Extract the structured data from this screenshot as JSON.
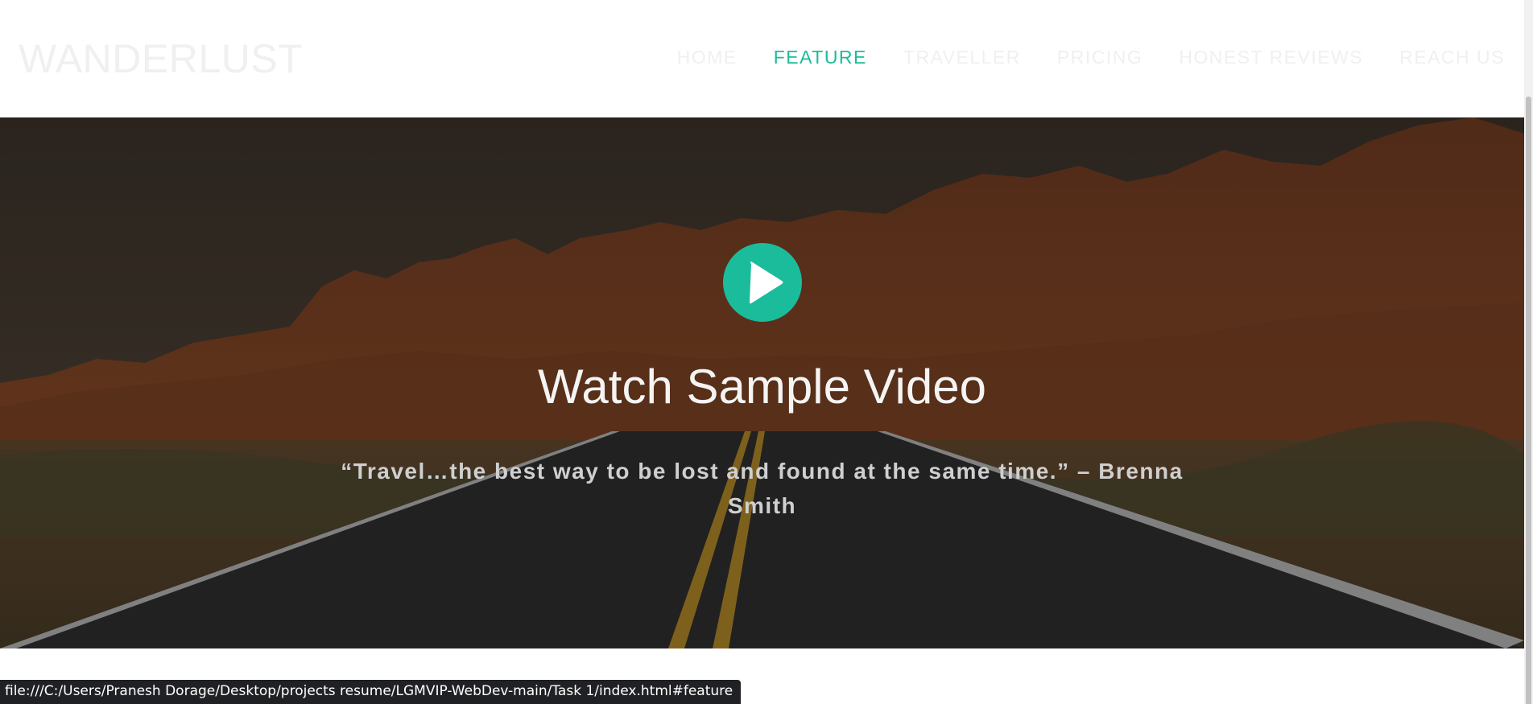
{
  "brand": {
    "logo_text": "WANDERLUST"
  },
  "nav": {
    "items": [
      {
        "label": "HOME",
        "active": false
      },
      {
        "label": "FEATURE",
        "active": true
      },
      {
        "label": "TRAVELLER",
        "active": false
      },
      {
        "label": "PRICING",
        "active": false
      },
      {
        "label": "HONEST REVIEWS",
        "active": false
      },
      {
        "label": "REACH US",
        "active": false
      }
    ]
  },
  "hero": {
    "title": "Watch Sample Video",
    "quote": "“Travel…the best way to be lost and found at the same time.” – Brenna Smith",
    "play_icon": "play-icon"
  },
  "status_bar": {
    "url": "file:///C:/Users/Pranesh Dorage/Desktop/projects resume/LGMVIP-WebDev-main/Task 1/index.html#feature"
  },
  "colors": {
    "accent": "#1bbc9b",
    "nav_inactive": "#f0f0f0",
    "title_text": "#f4f4f4"
  }
}
